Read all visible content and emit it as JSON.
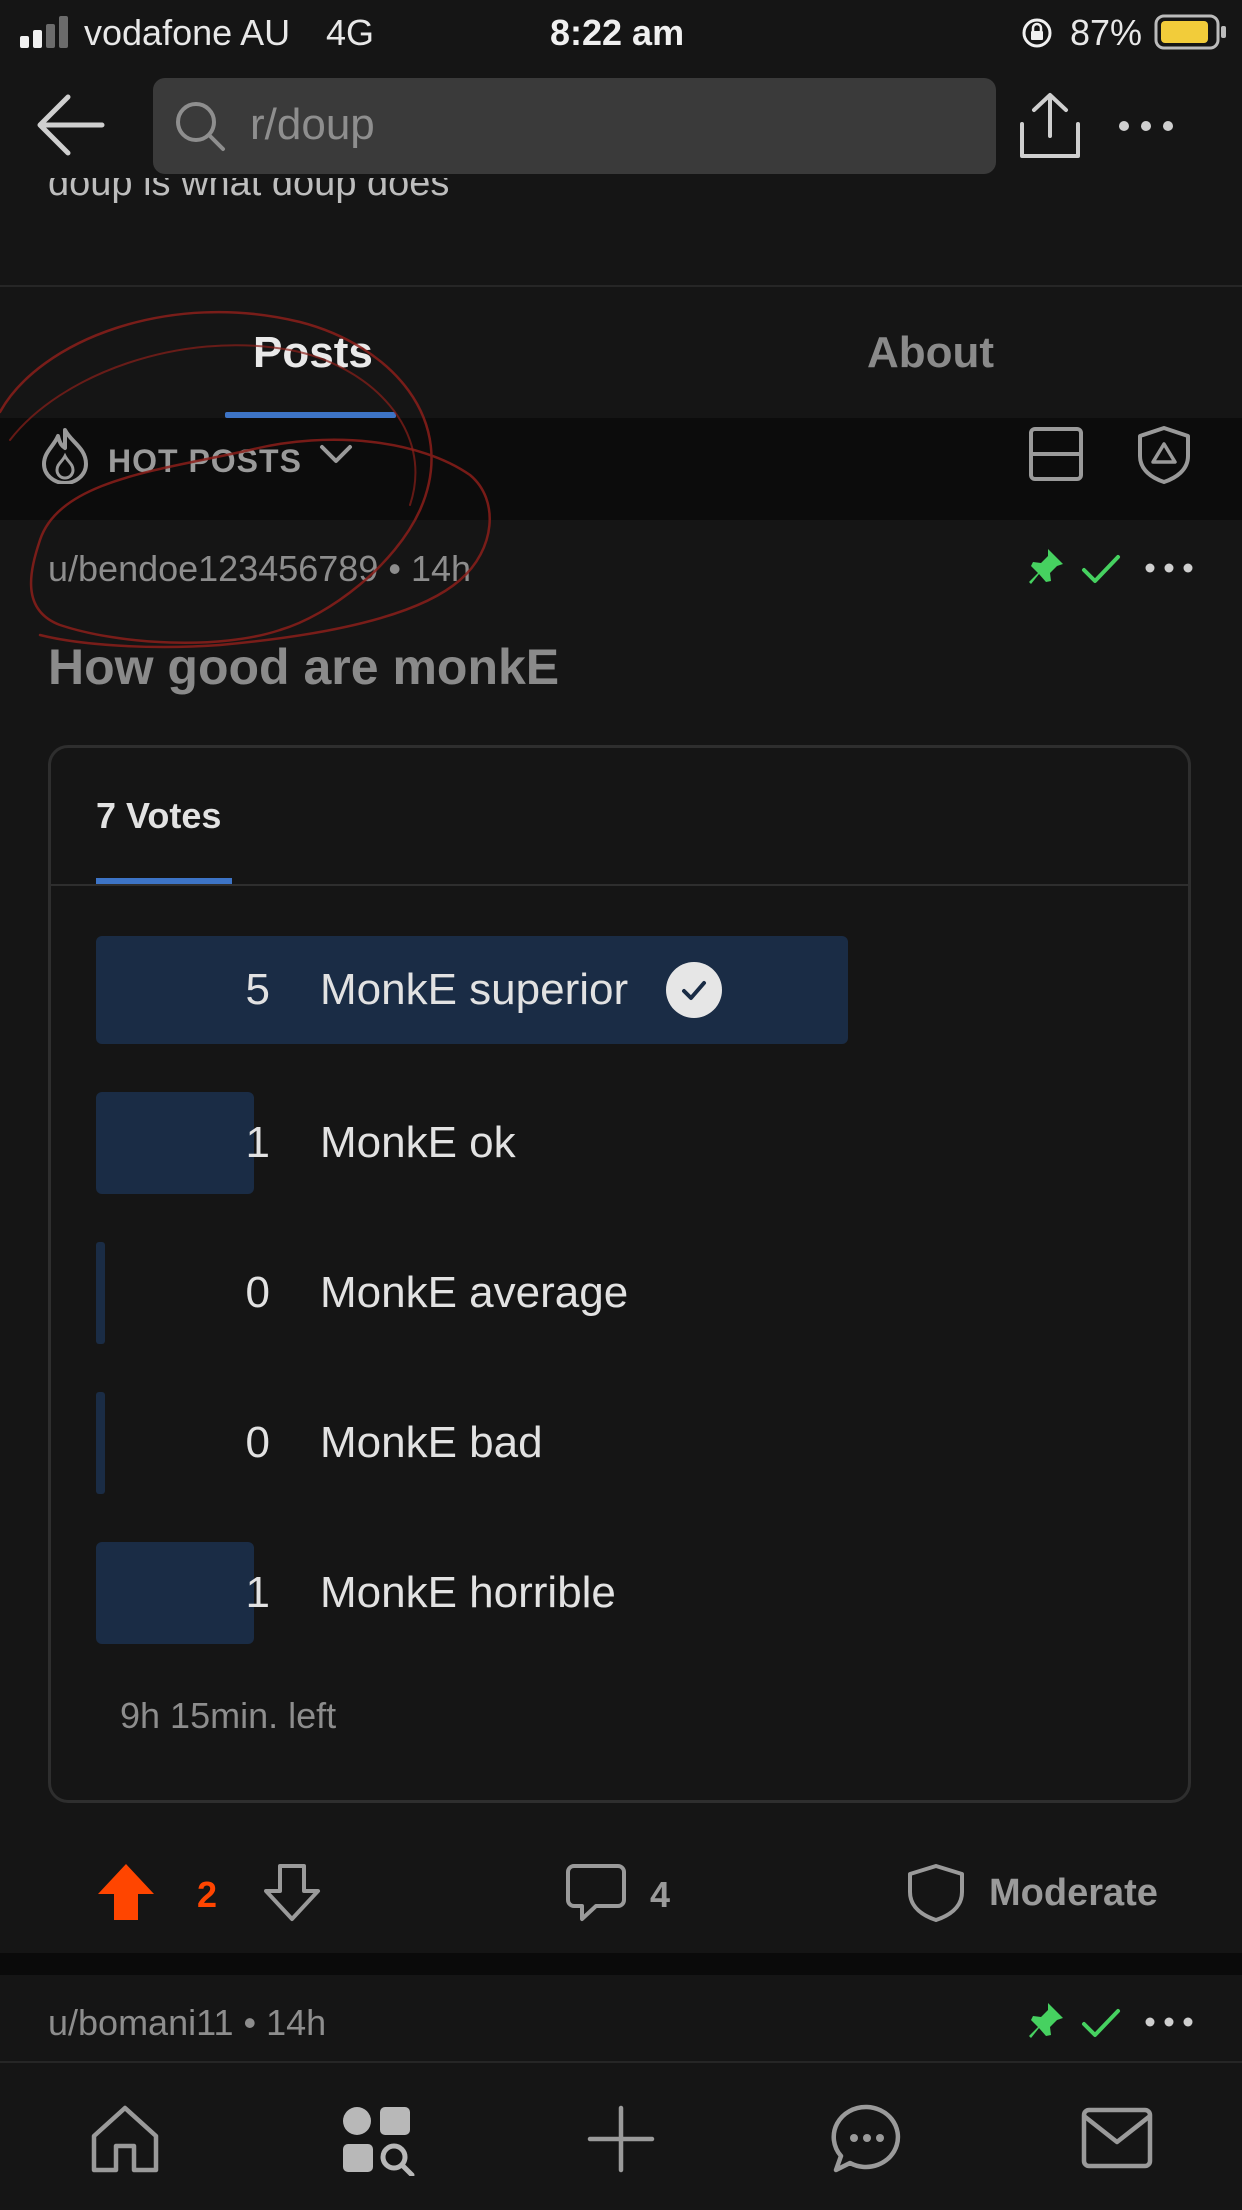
{
  "status_bar": {
    "carrier": "vodafone AU",
    "network": "4G",
    "time": "8:22 am",
    "battery": "87%",
    "battery_color": "#f2cc3a"
  },
  "nav": {
    "search_value": "r/doup",
    "icons": [
      "back-arrow-icon",
      "search-icon",
      "share-icon",
      "more-icon"
    ]
  },
  "subreddit": {
    "description": "doup is what doup does"
  },
  "tabs": [
    {
      "label": "Posts",
      "active": true
    },
    {
      "label": "About",
      "active": false
    }
  ],
  "sort": {
    "label": "HOT POSTS",
    "icons": [
      "flame-icon",
      "chevron-down-icon",
      "card-view-icon",
      "mod-shield-icon"
    ]
  },
  "post": {
    "author_meta": "u/bendoe123456789 • 14h",
    "title": "How good are monkE",
    "poll": {
      "votes_label": "7 Votes",
      "options": [
        {
          "count": "5",
          "label": "MonkE superior",
          "selected": true,
          "share": 0.714
        },
        {
          "count": "1",
          "label": "MonkE ok",
          "selected": false,
          "share": 0.143
        },
        {
          "count": "0",
          "label": "MonkE average",
          "selected": false,
          "share": 0
        },
        {
          "count": "0",
          "label": "MonkE bad",
          "selected": false,
          "share": 0
        },
        {
          "count": "1",
          "label": "MonkE horrible",
          "selected": false,
          "share": 0.143
        }
      ],
      "time_left": "9h 15min. left"
    },
    "actions": {
      "upvotes": "2",
      "comments": "4",
      "moderate_label": "Moderate",
      "upvote_color": "#ff4500"
    }
  },
  "next_post": {
    "author_meta": "u/bomani11 • 14h"
  },
  "accent_colors": {
    "tab_underline": "#3d74c6",
    "pin_green": "#46d160",
    "annotation_red": "#8b1f1a"
  },
  "bottom_nav": [
    "home-icon",
    "discover-icon",
    "create-icon",
    "chat-icon",
    "inbox-icon"
  ]
}
